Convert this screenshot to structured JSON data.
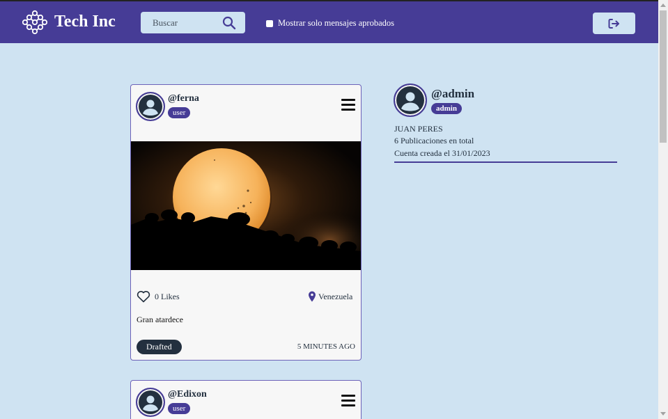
{
  "brand": {
    "name": "Tech Inc",
    "logo_icon": "molecule-logo-icon"
  },
  "search": {
    "placeholder": "Buscar",
    "icon": "search-icon"
  },
  "filter": {
    "label": "Mostrar solo mensajes aprobados",
    "checked": false
  },
  "logout": {
    "icon": "logout-icon"
  },
  "colors": {
    "header": "#463c96",
    "background": "#cfe3f2",
    "dark": "#23303f"
  },
  "posts": [
    {
      "username": "@ferna",
      "role": "user",
      "likes": "0 Likes",
      "location": "Venezuela",
      "caption": "Gran atardece",
      "status": "Drafted",
      "time": "5 MINUTES AGO"
    },
    {
      "username": "@Edixon",
      "role": "user"
    }
  ],
  "profile": {
    "username": "@admin",
    "role": "admin",
    "name": "JUAN PERES",
    "posts": "6 Publicaciones en total",
    "created": "Cuenta creada el 31/01/2023"
  }
}
